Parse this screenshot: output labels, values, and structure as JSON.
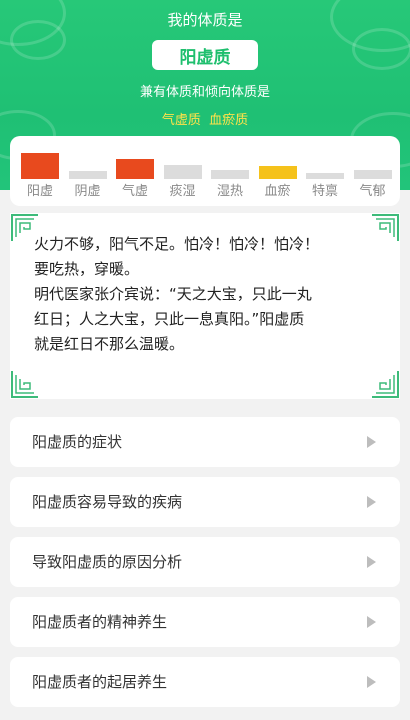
{
  "header": {
    "title": "我的体质是",
    "main_type": "阳虚质",
    "subtitle": "兼有体质和倾向体质是",
    "secondary_types": [
      "气虚质",
      "血瘀质"
    ]
  },
  "constitution_chart": {
    "items": [
      {
        "label": "阳虚",
        "level": 1.0,
        "color": "#e84a1e"
      },
      {
        "label": "阴虚",
        "level": 0.3,
        "color": "#dcdcdc"
      },
      {
        "label": "气虚",
        "level": 0.75,
        "color": "#e84a1e"
      },
      {
        "label": "痰湿",
        "level": 0.55,
        "color": "#dcdcdc"
      },
      {
        "label": "湿热",
        "level": 0.35,
        "color": "#dcdcdc"
      },
      {
        "label": "血瘀",
        "level": 0.5,
        "color": "#f5c21b"
      },
      {
        "label": "特禀",
        "level": 0.2,
        "color": "#dcdcdc"
      },
      {
        "label": "气郁",
        "level": 0.35,
        "color": "#dcdcdc"
      }
    ]
  },
  "description": {
    "lines": [
      "火力不够，阳气不足。怕冷！怕冷！怕冷！",
      "要吃热，穿暖。",
      "明代医家张介宾说：“天之大宝，只此一丸",
      "红日；人之大宝，只此一息真阳。”阳虚质",
      "就是红日不那么温暖。"
    ]
  },
  "menu": {
    "items": [
      {
        "label": "阳虚质的症状"
      },
      {
        "label": "阳虚质容易导致的疾病"
      },
      {
        "label": "导致阳虚质的原因分析"
      },
      {
        "label": "阳虚质者的精神养生"
      },
      {
        "label": "阳虚质者的起居养生"
      }
    ]
  },
  "colors": {
    "brand_green": "#1fc074",
    "accent_yellow": "#ffe24a",
    "border_green": "#3dbb7a"
  }
}
